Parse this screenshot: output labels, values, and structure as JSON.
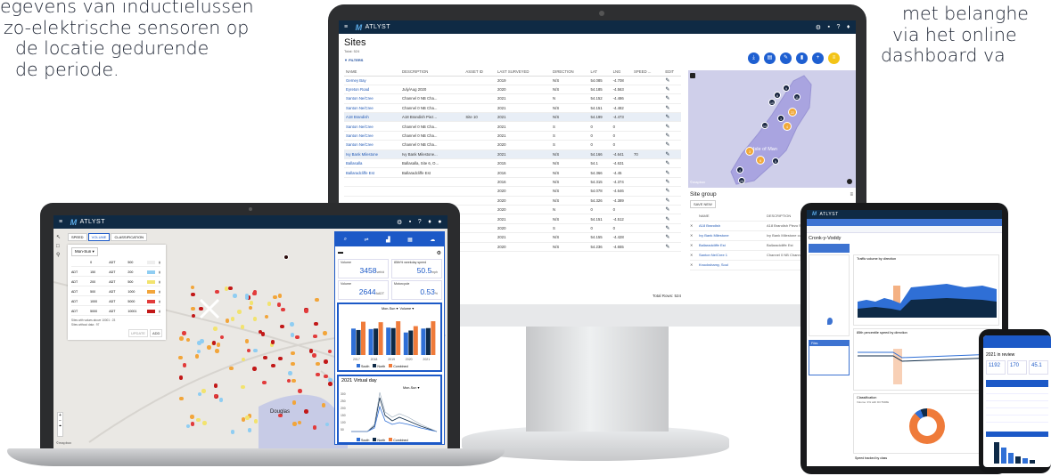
{
  "background_text": {
    "left_lines": [
      "egevens van inductielussen",
      "zo-elektrische sensoren op",
      "de locatie gedurende",
      "de periode."
    ],
    "right_lines": [
      "met belanghe",
      "via het online",
      "dashboard va"
    ]
  },
  "monitor": {
    "brand": "ATLYST",
    "page_title": "Sites",
    "total": "Total: 524",
    "filters_label": "FILTERS",
    "columns": [
      "NAME",
      "DESCRIPTION",
      "ASSET ID",
      "LAST SURVEYED",
      "DIRECTION",
      "LAT",
      "LNG",
      "SPEED ...",
      "EDIT"
    ],
    "rows": [
      [
        "Gerney Bay",
        "",
        "",
        "2019",
        "N/S",
        "54.085",
        "-4.708",
        ""
      ],
      [
        "Eyreton Road",
        "July/Aug 2020",
        "",
        "2020",
        "N/S",
        "54.185",
        "-4.563",
        ""
      ],
      [
        "Santon Ne/Cree",
        "Channel 0 NB Cha...",
        "",
        "2021",
        "N",
        "54.152",
        "-4.486",
        ""
      ],
      [
        "Santon Ne/Cree",
        "Channel 0 NB Cha...",
        "",
        "2021",
        "N/S",
        "54.151",
        "-4.482",
        ""
      ],
      [
        "A18 Brandish",
        "A18 Brandish Piez...",
        "Site 10",
        "2021",
        "N/S",
        "54.199",
        "-4.473",
        ""
      ],
      [
        "Santon Ne/Cree",
        "Channel 0 NB Cha...",
        "",
        "2021",
        "S",
        "0",
        "0",
        ""
      ],
      [
        "Santon Ne/Cree",
        "Channel 0 NB Cha...",
        "",
        "2021",
        "S",
        "0",
        "0",
        ""
      ],
      [
        "Santon Ne/Cree",
        "Channel 0 NB Cha...",
        "",
        "2020",
        "S",
        "0",
        "0",
        ""
      ],
      [
        "Ivy Bank Milestone",
        "Ivy Bank Milestone...",
        "",
        "2021",
        "N/S",
        "54.166",
        "-4.641",
        "70"
      ],
      [
        "Ballasalla",
        "Ballasalla, Site 6, O...",
        "",
        "2015",
        "N/S",
        "54.1",
        "-4.631",
        ""
      ],
      [
        "Ballaradcliffe Est",
        "Ballaradcliffe Est",
        "",
        "2016",
        "N/S",
        "54.366",
        "-4.45",
        ""
      ],
      [
        "",
        "",
        "",
        "2016",
        "N/S",
        "54.315",
        "-4.374",
        ""
      ],
      [
        "",
        "",
        "",
        "2020",
        "N/S",
        "54.078",
        "-4.646",
        ""
      ],
      [
        "",
        "",
        "",
        "2020",
        "N/S",
        "54.326",
        "-4.389",
        ""
      ],
      [
        "",
        "",
        "",
        "2020",
        "N",
        "0",
        "0",
        ""
      ],
      [
        "",
        "",
        "",
        "2021",
        "N/S",
        "54.151",
        "-4.512",
        ""
      ],
      [
        "",
        "",
        "",
        "2020",
        "S",
        "0",
        "0",
        ""
      ],
      [
        "",
        "",
        "",
        "2021",
        "N/S",
        "54.155",
        "-4.428",
        ""
      ],
      [
        "",
        "",
        "",
        "2020",
        "N/S",
        "54.236",
        "-4.655",
        ""
      ]
    ],
    "total_rows": "Total Rows: 524",
    "map_label": "Isle of Man",
    "map_logo": "©mapbox",
    "clusters": [
      "9",
      "6",
      "11",
      "10",
      "22",
      "3",
      "14",
      "4",
      "3",
      "6",
      "5",
      "4",
      "28"
    ],
    "site_group": {
      "title": "Site group",
      "save_button": "SAVE NEW",
      "columns": [
        "",
        "NAME",
        "DESCRIPTION"
      ],
      "rows": [
        [
          "A18 Brandish",
          "A18 Brandish Piezo Site"
        ],
        [
          "Ivy Bank Milestone",
          "Ivy Bank Milestone cutte"
        ],
        [
          "Ballaradcliffe Est",
          "Ballaradcliffe Est"
        ],
        [
          "Santon Ne/Cree 1",
          "Channel 0 NB Channel"
        ],
        [
          "Knockshamy, Soul",
          ""
        ]
      ]
    }
  },
  "laptop": {
    "brand": "ATLYST",
    "tabs": [
      "SPEED",
      "VOLUME",
      "CLASSIFICATION"
    ],
    "range_select": "Mon-Sun",
    "legend_rows": [
      [
        "",
        "0",
        "ADT",
        "500"
      ],
      [
        "ADT",
        "150",
        "ADT",
        "200"
      ],
      [
        "ADT",
        "200",
        "ADT",
        "500"
      ],
      [
        "ADT",
        "500",
        "ADT",
        "1000"
      ],
      [
        "ADT",
        "1000",
        "ADT",
        "5000"
      ],
      [
        "ADT",
        "5000",
        "ADT",
        "10001"
      ]
    ],
    "legend_note1": "Sites with values above 10001 : 23",
    "legend_note2": "Sites without data : 97",
    "update_button": "UPDATE",
    "add_button": "ADD",
    "kpi": {
      "volume_label": "Volume",
      "volume_value": "3458",
      "volume_unit": "veh/d",
      "speed_label": "85th% weekday speed",
      "speed_value": "50.5",
      "speed_unit": "mph",
      "volume2_label": "Volume",
      "volume2_value": "2644",
      "volume2_unit": "AADT",
      "motorcycle_label": "Motorcycle",
      "motorcycle_value": "0.53",
      "motorcycle_unit": "%"
    },
    "bar_selects": [
      "Mon-Sun",
      "Volume"
    ],
    "bar_years": [
      "2017",
      "2018",
      "2019",
      "2020",
      "2021"
    ],
    "legend_south": "South",
    "legend_north": "North",
    "legend_combined": "Combined",
    "virtual_title": "2021 Virtual day",
    "virtual_select": "Mon-Sun",
    "virtual_y": [
      "300",
      "250",
      "200",
      "150",
      "100",
      "50"
    ],
    "mapbox": "©mapbox",
    "town": "Douglas"
  },
  "tablet": {
    "brand": "ATLYST",
    "site_name": "Cronk-y-Voddy",
    "chart1_title": "Traffic volume by direction",
    "chart2_title": "85th percentile speed by direction",
    "chart3_title": "Classification",
    "chart3_sub": "Volume: 3% with DCTMME",
    "bottom_label": "Speed tracked by class",
    "files_label": "Files"
  },
  "phone": {
    "title": "2021 in review",
    "kpis": [
      "1192",
      "170",
      "45.1"
    ]
  },
  "chart_data": {
    "type": "bar",
    "categories": [
      "2017",
      "2018",
      "2019",
      "2020",
      "2021"
    ],
    "series": [
      {
        "name": "South",
        "values": [
          2700,
          2650,
          2800,
          2300,
          2700
        ]
      },
      {
        "name": "North",
        "values": [
          2550,
          2700,
          2750,
          2500,
          2750
        ]
      },
      {
        "name": "Combined",
        "values": [
          3400,
          3350,
          3450,
          2950,
          3450
        ]
      }
    ],
    "colors": [
      "#2f6fd6",
      "#0e2a47",
      "#ef7b3a"
    ]
  }
}
